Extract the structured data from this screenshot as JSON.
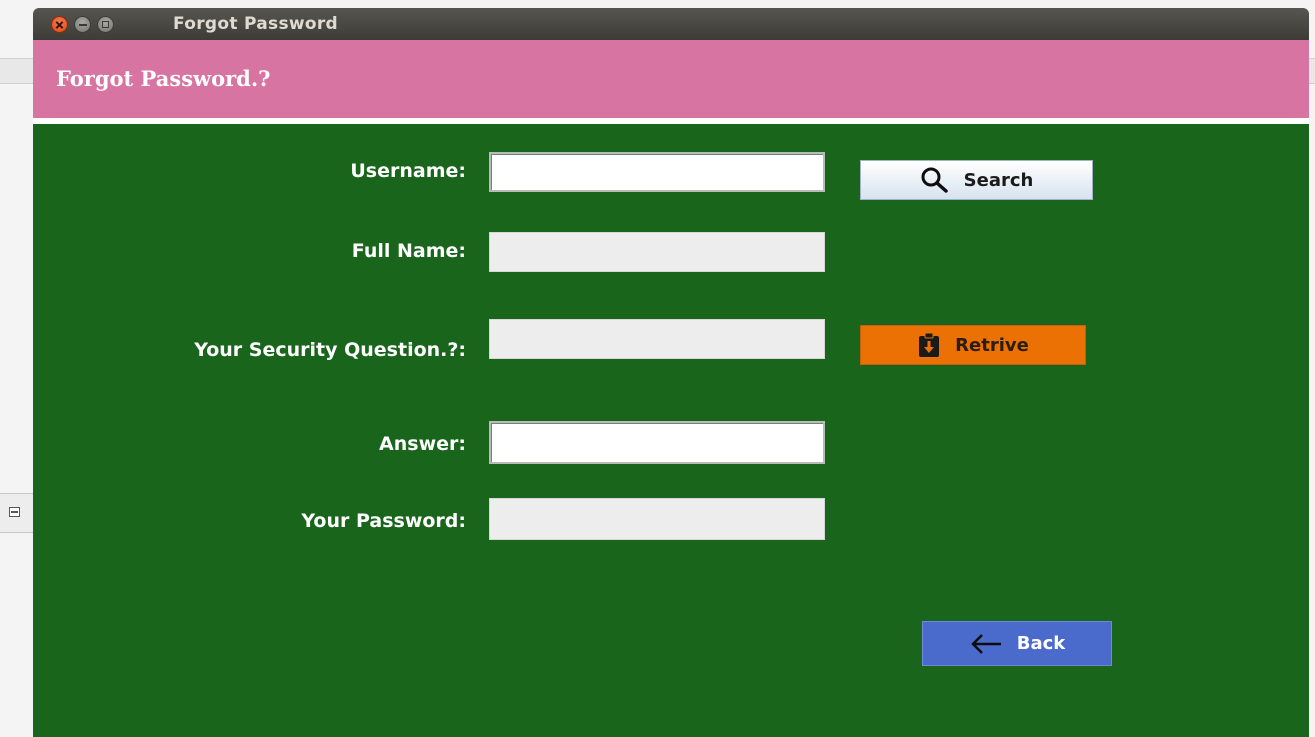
{
  "window": {
    "title": "Forgot Password"
  },
  "header": {
    "title": "Forgot Password.?"
  },
  "form": {
    "username_label": "Username:",
    "username_value": "",
    "fullname_label": "Full Name:",
    "fullname_value": "",
    "security_question_label": "Your Security Question.?:",
    "security_question_value": "",
    "answer_label": "Answer:",
    "answer_value": "",
    "password_label": "Your Password:",
    "password_value": ""
  },
  "buttons": {
    "search_label": "Search",
    "search_icon": "search-icon",
    "retrive_label": "Retrive",
    "retrive_icon": "clipboard-download-icon",
    "back_label": "Back",
    "back_icon": "arrow-left-icon"
  },
  "colors": {
    "header_bg": "#d874a1",
    "body_bg": "#19651c",
    "retrive_bg": "#ec7105",
    "back_bg": "#4a6bcc",
    "titlebar_bg": "#3d3c38"
  }
}
